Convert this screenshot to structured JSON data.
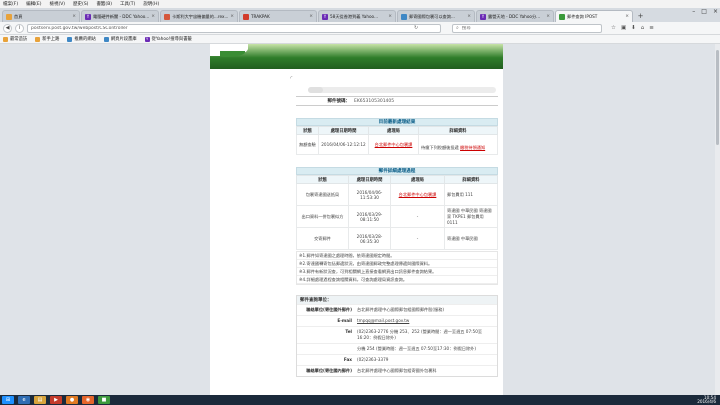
{
  "menubar": [
    "檔案(F)",
    "編輯(E)",
    "檢視(V)",
    "歷史(S)",
    "書籤(B)",
    "工具(T)",
    "說明(H)"
  ],
  "tabs": [
    {
      "title": "首頁",
      "color": "#e8a23a",
      "glyph": "",
      "active": false
    },
    {
      "title": "電腦硬件新聞 - DDC Yahoo...",
      "color": "#6b2bb5",
      "glyph": "Y",
      "active": false
    },
    {
      "title": "卡斯利大宇宙機偏量的...rex...",
      "color": "#d5573b",
      "glyph": "",
      "active": false
    },
    {
      "title": "TRAKPAK",
      "color": "#d23b2b",
      "glyph": "",
      "active": false
    },
    {
      "title": "58天從香港到義 Yahoo...",
      "color": "#6b2bb5",
      "glyph": "Y",
      "active": false
    },
    {
      "title": "郵寄國際包裹可以查詢...",
      "color": "#3f88c5",
      "glyph": "",
      "active": false
    },
    {
      "title": "露營天地 - DDC Yahoo分...",
      "color": "#6b2bb5",
      "glyph": "Y",
      "active": false
    },
    {
      "title": "郵件查詢 IPOST",
      "color": "#3a9a3a",
      "glyph": "",
      "active": true
    }
  ],
  "nav": {
    "url": "postserv.post.gov.tw/webpost/CSController",
    "search_placeholder": "搜尋"
  },
  "bookmarks": [
    {
      "label": "最常造訪",
      "color": "#e8a23a",
      "glyph": ""
    },
    {
      "label": "新手上路",
      "color": "#e8a23a",
      "glyph": ""
    },
    {
      "label": "推薦的網站",
      "color": "#3f88c5",
      "glyph": ""
    },
    {
      "label": "網頁片段畫庫",
      "color": "#3f88c5",
      "glyph": ""
    },
    {
      "label": "從Yahoo!搜尋與書籤",
      "color": "#6b2bb5",
      "glyph": "Y"
    }
  ],
  "mail": {
    "label": "郵件號碼：",
    "number": "EK653105301405"
  },
  "status_section": {
    "title": "目前最新處理結果",
    "headers": [
      "狀態",
      "處理日期時間",
      "處理局",
      "詳細資料"
    ],
    "row": {
      "status": "無額查驗",
      "datetime": "2016/04/06-12:12:12",
      "office": "台北郵件中心包裹課",
      "detail_prefix": "待繳下列稅額後投遞 ",
      "detail_link": "繳稅待領通知"
    }
  },
  "history_section": {
    "title": "郵件詳細處理過程",
    "headers": [
      "狀態",
      "處理日期時間",
      "處理局",
      "詳細資料"
    ],
    "rows": [
      {
        "status": "包裹寄達國送抵局",
        "datetime": "2016/04/06-11:53:30",
        "office": "台北郵件中心包裹課",
        "office_link": true,
        "detail": "郵包費用 111"
      },
      {
        "status": "出口資料一併包裹似方",
        "datetime": "2016/03/29-08:11:50",
        "office": "-",
        "office_link": false,
        "detail": "寄達國 中華民國 寄達國家 TKPE1 郵包費用 0111"
      },
      {
        "status": "交寄郵件",
        "datetime": "2016/03/28-06:35:30",
        "office": "-",
        "office_link": false,
        "detail": "寄達國 中華民國"
      }
    ]
  },
  "notes": [
    "※1.郵件如寄達國之處理時間，依寄達國規定時間。",
    "※2.寄達國轉寄包括郵遞狀況，由寄達國郵政完整處理傳遞與國際資料。",
    "※3.郵件有新狀況查，可到相關網上直接查看網頁出口訊息郵件查詢結果。",
    "※4.詳細處理過程查詢相關資料，可查詢處理局資訊查詢。"
  ],
  "contact": {
    "title": "郵件查詢單位：",
    "rows": [
      {
        "key": "聯絡單位(寄往國外郵件)",
        "value": "台北郵件處理中心國際郵包組國際郵件股(服務)"
      },
      {
        "key": "E-mail",
        "value": "tmpqq@mail.post.gov.tw"
      },
      {
        "key": "Tel",
        "value": "(02)2363-2776 分機 253、252 (營業時間：週一至週五 07:50至16:20：例假日除外)"
      },
      {
        "key": "",
        "value": "分機 254 (營業時間：週一至週五 07:50至17:30：例假日除外)"
      },
      {
        "key": "Fax",
        "value": "(02)2363-3379"
      },
      {
        "key": "聯絡單位(寄往國內郵件)",
        "value": "台北郵件處理中心國際郵包組寄國外包裹科"
      }
    ]
  },
  "taskbar": {
    "apps": [
      {
        "name": "windows-start",
        "color": "#1e90ff",
        "glyph": "⊞"
      },
      {
        "name": "ie",
        "color": "#2f6db3",
        "glyph": "e"
      },
      {
        "name": "explorer",
        "color": "#d8a43c",
        "glyph": "▤"
      },
      {
        "name": "media",
        "color": "#c43b2b",
        "glyph": "▶"
      },
      {
        "name": "app-orange",
        "color": "#e07a22",
        "glyph": "●"
      },
      {
        "name": "firefox",
        "color": "#e5652b",
        "glyph": "◉"
      },
      {
        "name": "app-green",
        "color": "#3d9a3d",
        "glyph": "■"
      }
    ],
    "time": "10:54",
    "date": "2016/4/6"
  }
}
